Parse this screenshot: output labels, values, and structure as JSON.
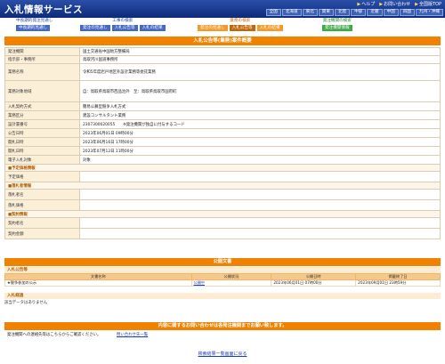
{
  "header": {
    "title": "入札情報サービス",
    "top_links": [
      "ヘルプ",
      "お問い合わせ",
      "全国版TOP"
    ],
    "regions": [
      "全国",
      "北海道",
      "東北",
      "関東",
      "北陸",
      "中部",
      "近畿",
      "中国",
      "四国",
      "九州・沖縄"
    ]
  },
  "menu": {
    "groups": [
      {
        "title": "中長期的発注見通し",
        "buttons": [
          "中長期的見通し"
        ],
        "color": "blue"
      },
      {
        "title": "工事の検索",
        "buttons": [
          "発注の見通し",
          "入札公告等",
          "入札の結果"
        ],
        "color": "blue"
      },
      {
        "title": "業務の検索",
        "buttons": [
          "発注の見通し",
          "入札公告等",
          "入札の結果"
        ],
        "color": "orange"
      },
      {
        "title": "発注機関の検索",
        "buttons": [
          "発注機関情報"
        ],
        "color": "green"
      }
    ]
  },
  "detail": {
    "title": "入札公告等(業務)案件概要",
    "rows": [
      {
        "label": "発注機関",
        "value": "国土交通省中国地方整備局"
      },
      {
        "label": "指示部・事務所",
        "value": "鳥取河川国道事務所"
      },
      {
        "label": "業務名称",
        "value": "令和5年度岩戸地区外設計業務等委託業務"
      },
      {
        "label": "業務対象地域",
        "value": "自：鳥取県鳥取市西品治外　至：鳥取県鳥取市国府町"
      },
      {
        "label": "入札契約方式",
        "value": "簡易公募型競争入札方式"
      },
      {
        "label": "業務区分",
        "value": "建設コンサルタント業務"
      },
      {
        "label": "設計書番号",
        "value": "2307300020055　　※発注機関が独自に付与するコード"
      },
      {
        "label": "公告日時",
        "value": "2023年06月01日 09時00分"
      },
      {
        "label": "開札日時",
        "value": "2023年06月16日 17時00分"
      },
      {
        "label": "開札日時",
        "value": "2023年07月12日 11時00分"
      },
      {
        "label": "電子入札対象",
        "value": "対象"
      }
    ],
    "sections": {
      "planned": "■予定価格情報",
      "winner": "■落札者情報",
      "contract": "■契約情報"
    },
    "planned_rows": [
      {
        "label": "予定価格",
        "value": ""
      }
    ],
    "winner_rows": [
      {
        "label": "落札者名",
        "value": ""
      },
      {
        "label": "落札価格",
        "value": ""
      }
    ],
    "contract_rows": [
      {
        "label": "契約者名",
        "value": ""
      },
      {
        "label": "契約金額",
        "value": ""
      }
    ]
  },
  "documents": {
    "title": "公開文書",
    "subtitle": "入札公告等",
    "headers": [
      "文書名称",
      "公開状況",
      "公開日時",
      "掲載終了日"
    ],
    "rows": [
      {
        "name": "★競争参加の公示",
        "status": "公開中",
        "published": "2023年06月01日 07時00分",
        "end": "2023年09月01日 23時59分"
      }
    ],
    "status_subtitle": "入札経過",
    "status_text": "該当データはありません"
  },
  "contact": {
    "title": "内容に関するお問い合わせは各発注機関までお願い致します。",
    "text": "発注機関への連絡先等はこちらからご確認ください。",
    "link": "問い合わせ先一覧"
  },
  "footer": {
    "back_link": "検索結果一覧画面に戻る"
  }
}
